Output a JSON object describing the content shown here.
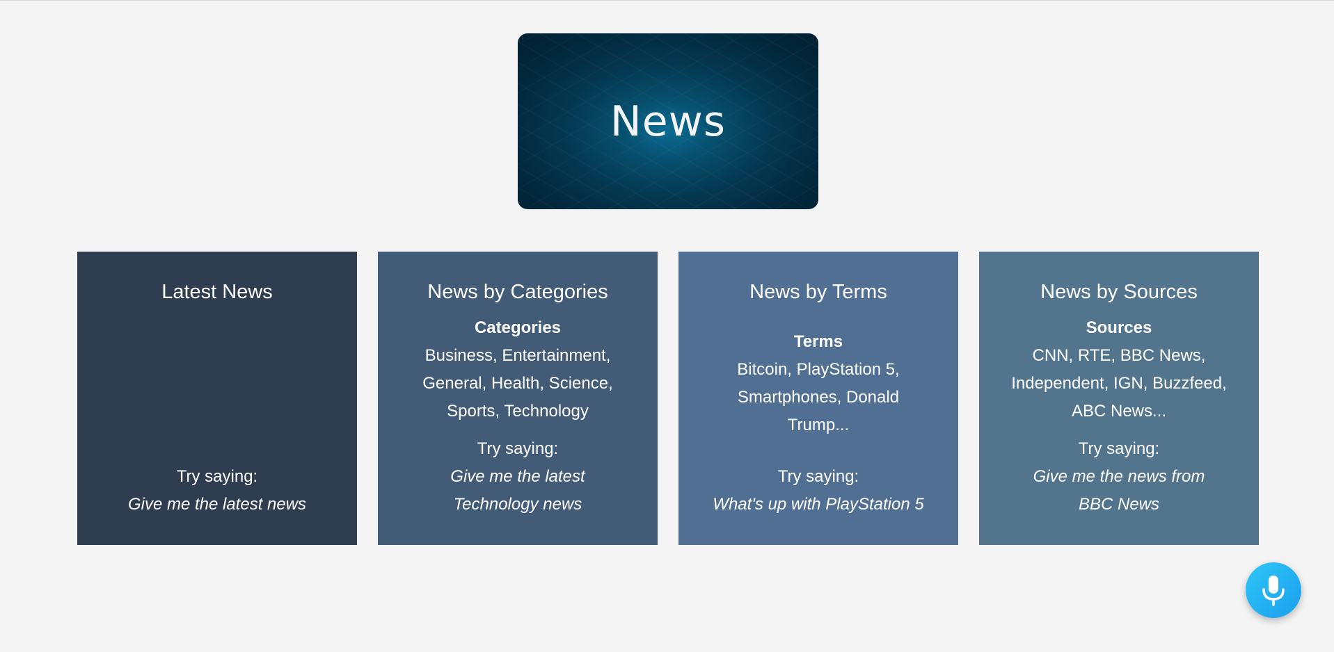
{
  "header": {
    "logo_text": "News"
  },
  "cards": [
    {
      "title": "Latest News",
      "try_label": "Try saying:",
      "example": "Give me the latest news"
    },
    {
      "title": "News by Categories",
      "list_label": "Categories",
      "list_text": "Business, Entertainment, General, Health, Science, Sports, Technology",
      "try_label": "Try saying:",
      "example": "Give me the latest Technology news"
    },
    {
      "title": "News by Terms",
      "list_label": "Terms",
      "list_text": "Bitcoin, PlayStation 5, Smartphones, Donald Trump...",
      "try_label": "Try saying:",
      "example": "What's up with PlayStation 5"
    },
    {
      "title": "News by Sources",
      "list_label": "Sources",
      "list_text": "CNN, RTE, BBC News, Independent, IGN, Buzzfeed, ABC News...",
      "try_label": "Try saying:",
      "example": "Give me the news from BBC News"
    }
  ],
  "mic_button": {
    "icon": "microphone-icon"
  },
  "colors": {
    "background": "#f4f4f4",
    "card_1": "#2e3d50",
    "card_2": "#425b77",
    "card_3": "#516f92",
    "card_4": "#52748c",
    "mic_accent": "#1b9ff0"
  }
}
